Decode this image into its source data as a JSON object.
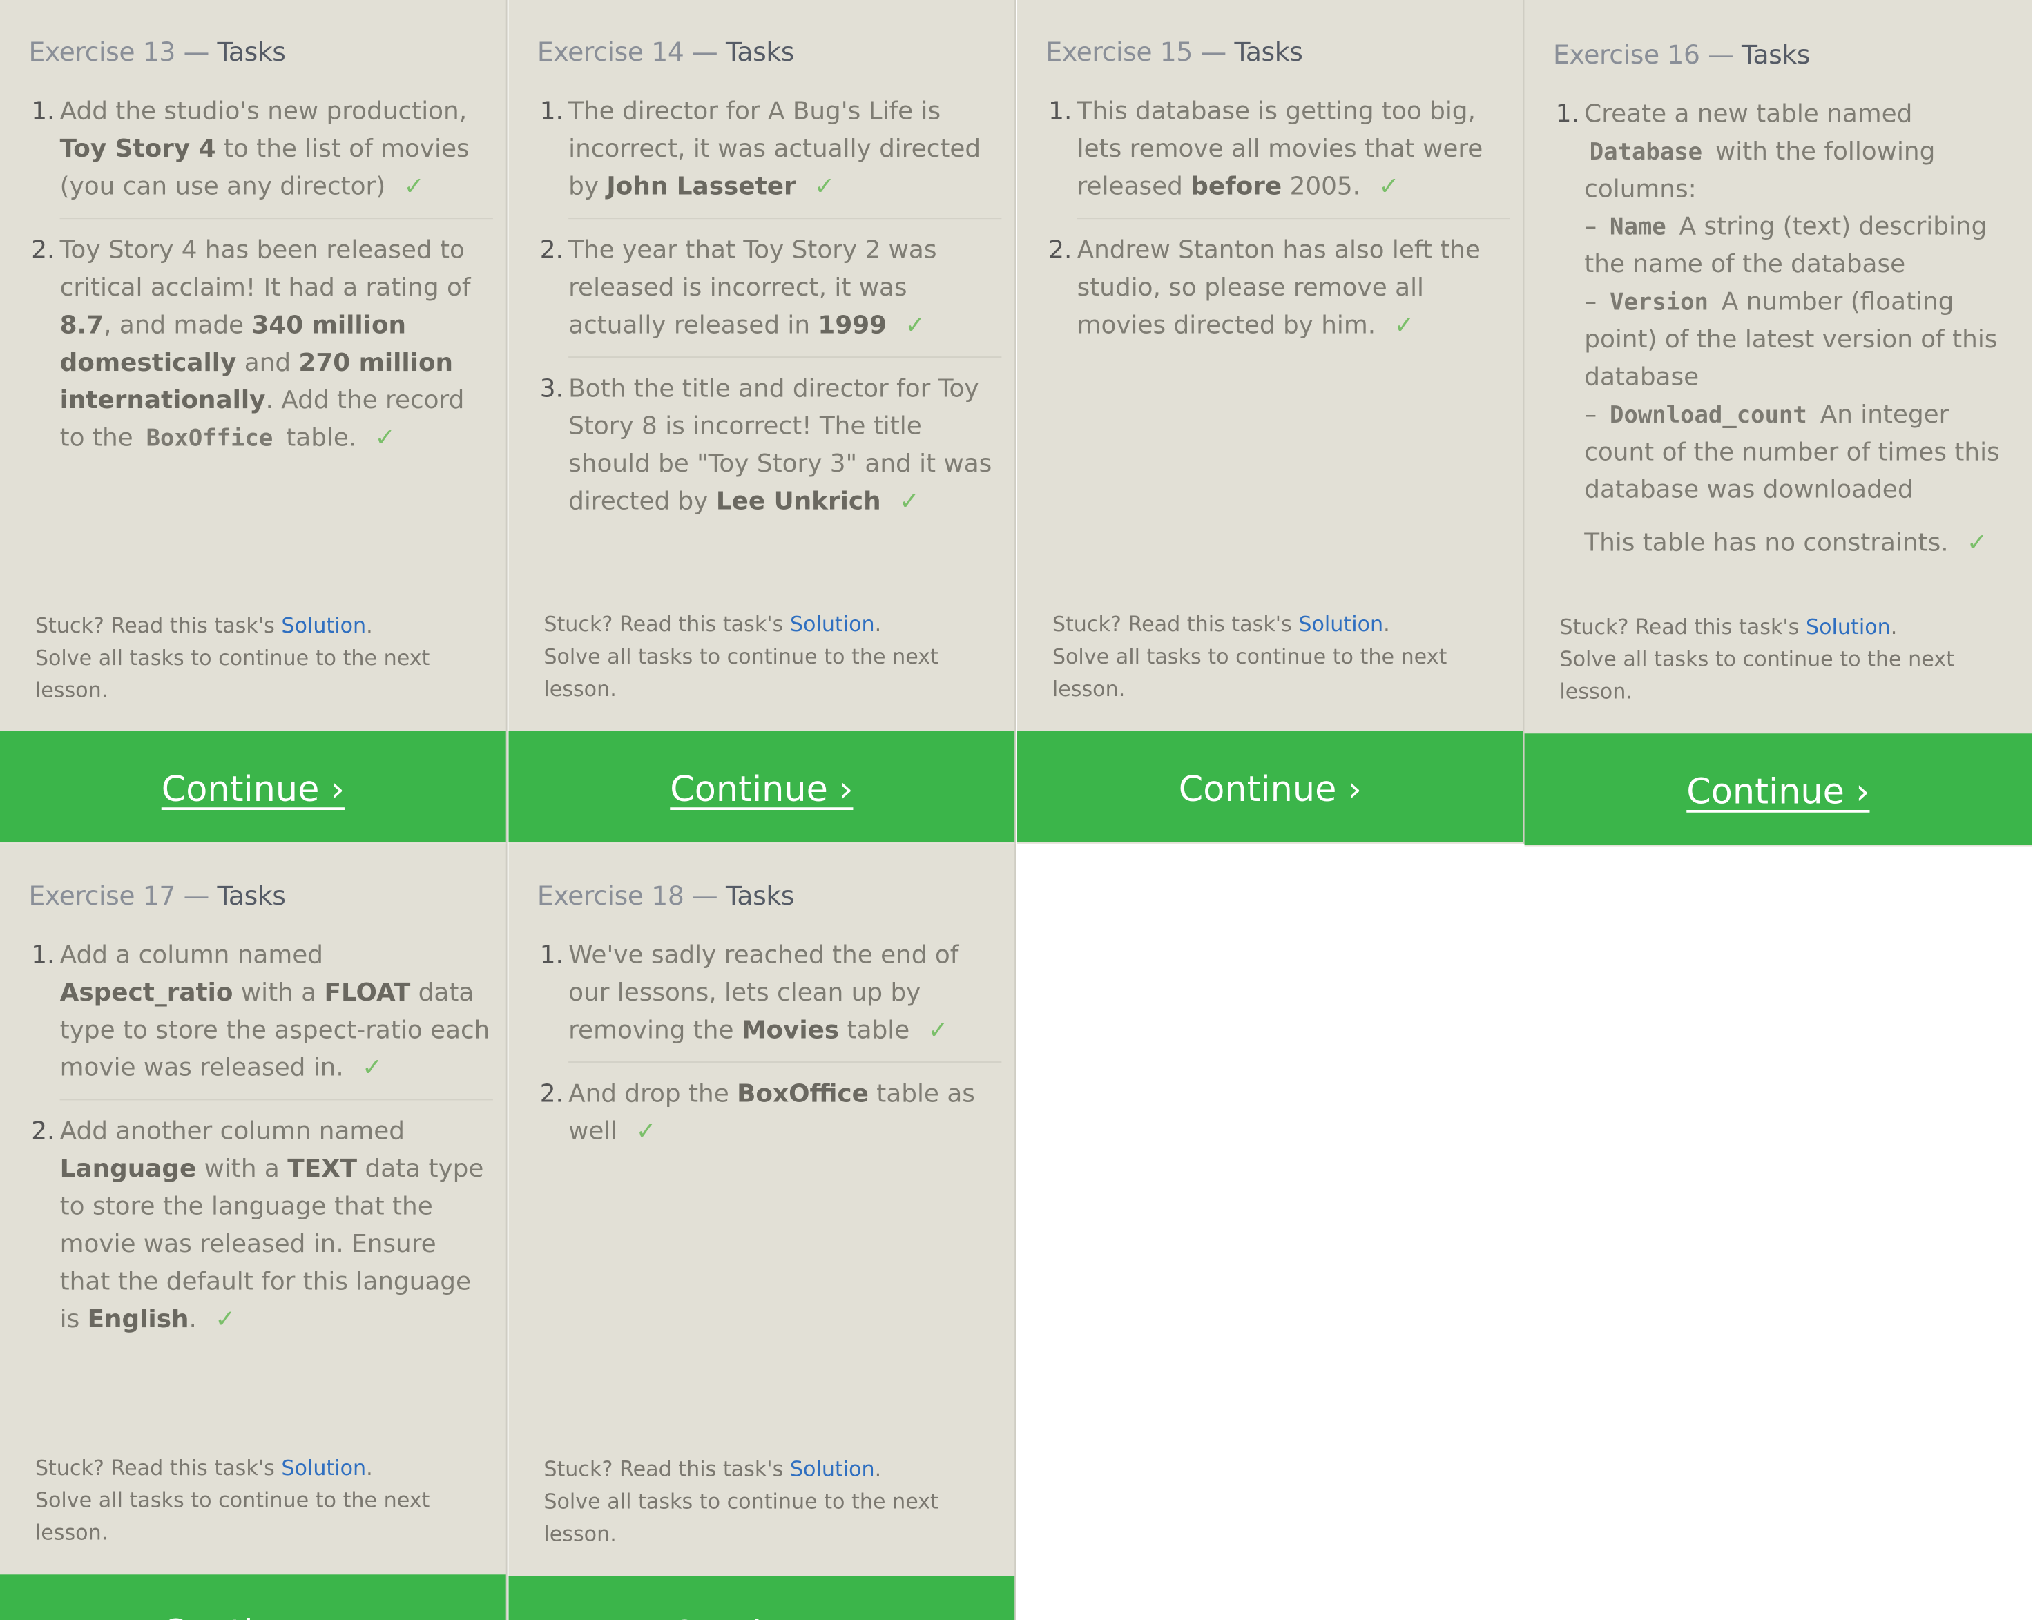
{
  "continue_label": "Continue ›",
  "stuck_prefix": "Stuck? Read this task's ",
  "solution_link": "Solution",
  "period": ".",
  "solve_all": "Solve all tasks to continue to the next lesson.",
  "check_mark": "✓",
  "dash": "– ",
  "colors": {
    "panel_bg": "#e2e0d6",
    "continue_bg": "#3bb54a",
    "link": "#2f6fc0",
    "check": "#7bbf6a"
  },
  "exercises": [
    {
      "title_prefix": "Exercise 13 — ",
      "title_strong": "Tasks",
      "tasks": [
        {
          "num": "1.",
          "parts": [
            "Add the studio's new production, ",
            "Toy Story 4",
            " to the list of movies (you can use any director)"
          ]
        },
        {
          "num": "2.",
          "parts": [
            "Toy Story 4 has been released to critical acclaim! It had a rating of ",
            "8.7",
            ", and made ",
            "340 million domestically",
            " and ",
            "270 million internationally",
            ". Add the record to the ",
            "BoxOffice",
            " table."
          ]
        }
      ]
    },
    {
      "title_prefix": "Exercise 14 — ",
      "title_strong": "Tasks",
      "tasks": [
        {
          "num": "1.",
          "parts": [
            "The director for A Bug's Life is incorrect, it was actually directed by ",
            "John Lasseter"
          ]
        },
        {
          "num": "2.",
          "parts": [
            "The year that Toy Story 2 was released is incorrect, it was actually released in ",
            "1999"
          ]
        },
        {
          "num": "3.",
          "parts": [
            "Both the title and director for Toy Story 8 is incorrect! The title should be \"Toy Story 3\" and it was directed by ",
            "Lee Unkrich"
          ]
        }
      ]
    },
    {
      "title_prefix": "Exercise 15 — ",
      "title_strong": "Tasks",
      "tasks": [
        {
          "num": "1.",
          "parts": [
            "This database is getting too big, lets remove all movies that were released ",
            "before",
            " 2005."
          ]
        },
        {
          "num": "2.",
          "parts": [
            "Andrew Stanton has also left the studio, so please remove all movies directed by him."
          ]
        }
      ]
    },
    {
      "title_prefix": "Exercise 16 — ",
      "title_strong": "Tasks",
      "tasks": [
        {
          "num": "1.",
          "intro": "Create a new table named ",
          "table_name": "Database",
          "intro_end": " with the following columns:",
          "columns": [
            {
              "name": "Name",
              "desc": " A string (text) describing the name of the database"
            },
            {
              "name": "Version",
              "desc": " A number (floating point) of the latest version of this database"
            },
            {
              "name": "Download_count",
              "desc": " An integer count of the number of times this database was downloaded"
            }
          ],
          "note": "This table has no constraints."
        }
      ]
    },
    {
      "title_prefix": "Exercise 17 — ",
      "title_strong": "Tasks",
      "tasks": [
        {
          "num": "1.",
          "parts": [
            "Add a column named ",
            "Aspect_ratio",
            " with a ",
            "FLOAT",
            " data type to store the aspect-ratio each movie was released in."
          ]
        },
        {
          "num": "2.",
          "parts": [
            "Add another column named ",
            "Language",
            " with a ",
            "TEXT",
            " data type to store the language that the movie was released in. Ensure that the default for this language is ",
            "English",
            "."
          ]
        }
      ]
    },
    {
      "title_prefix": "Exercise 18 — ",
      "title_strong": "Tasks",
      "tasks": [
        {
          "num": "1.",
          "parts": [
            "We've sadly reached the end of our lessons, lets clean up by removing the ",
            "Movies",
            " table"
          ]
        },
        {
          "num": "2.",
          "parts": [
            "And drop the ",
            "BoxOffice",
            " table as well"
          ]
        }
      ]
    }
  ]
}
